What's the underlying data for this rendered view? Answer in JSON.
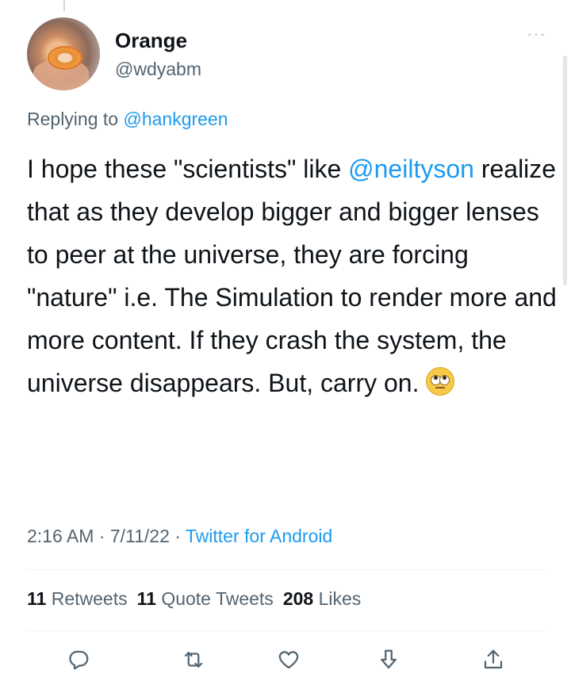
{
  "author": {
    "display_name": "Orange",
    "handle": "@wdyabm",
    "avatar_icon": "orange-ring-avatar"
  },
  "reply": {
    "prefix": "Replying to ",
    "mention": "@hankgreen"
  },
  "tweet": {
    "part1": "I hope these \"scientists\" like ",
    "mention": "@neiltyson",
    "part2": " realize that as they develop bigger and bigger lenses to peer at the universe, they are forcing \"nature\" i.e. The Simulation to render more and more content. If they crash the system, the universe disappears. But, carry on. ",
    "emoji_icon": "face-with-rolling-eyes-emoji"
  },
  "meta": {
    "time": "2:16 AM",
    "sep1": " · ",
    "date": "7/11/22",
    "sep2": " · ",
    "source": "Twitter for Android"
  },
  "stats": {
    "retweets_count": "11",
    "retweets_label": "Retweets",
    "quotes_count": "11",
    "quotes_label": "Quote Tweets",
    "likes_count": "208",
    "likes_label": "Likes"
  },
  "actions": [
    "reply-icon",
    "retweet-icon",
    "like-icon",
    "bookmark-icon",
    "share-icon"
  ],
  "colors": {
    "accent": "#1d9bf0",
    "text": "#0f1419",
    "secondary": "#536471"
  }
}
